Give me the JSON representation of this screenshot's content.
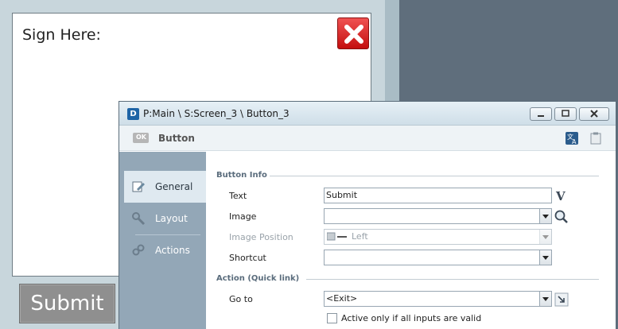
{
  "background_form": {
    "sign_label": "Sign Here:",
    "submit_label": "Submit"
  },
  "dialog": {
    "title": "P:Main \\ S:Screen_3 \\ Button_3",
    "logo": "D",
    "header_title": "Button",
    "nav": [
      {
        "label": "General",
        "icon": "pencil-icon",
        "selected": true
      },
      {
        "label": "Layout",
        "icon": "wrench-icon",
        "selected": false
      },
      {
        "label": "Actions",
        "icon": "link-icon",
        "selected": false
      }
    ],
    "sections": {
      "button_info": "Button Info",
      "action": "Action (Quick link)"
    },
    "fields": {
      "text_label": "Text",
      "text_value": "Submit",
      "image_label": "Image",
      "image_value": "",
      "image_position_label": "Image Position",
      "image_position_value": "Left",
      "shortcut_label": "Shortcut",
      "shortcut_value": "",
      "goto_label": "Go to",
      "goto_value": "<Exit>",
      "active_label": "Active only if all inputs are valid",
      "active_checked": false
    }
  },
  "colors": {
    "desktop": "#5f6e7c",
    "sidebar": "#93a7b7",
    "selected_nav": "#dfe9f0",
    "close_red": "#d42020"
  }
}
